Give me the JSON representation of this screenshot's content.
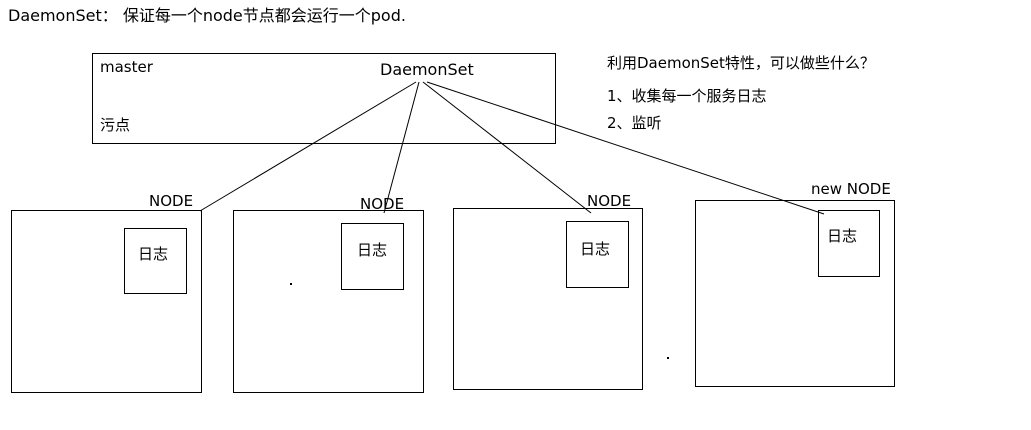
{
  "header": {
    "text": "DaemonSet： 保证每一个node节点都会运行一个pod."
  },
  "master_box": {
    "label": "master",
    "taint_label": "污点",
    "daemonset_label": "DaemonSet"
  },
  "notes": {
    "question": "利用DaemonSet特性，可以做些什么？",
    "items": [
      "1、收集每一个服务日志",
      "2、监听"
    ]
  },
  "nodes": [
    {
      "label": "NODE",
      "log_label": "日志"
    },
    {
      "label": "NODE",
      "log_label": "日志"
    },
    {
      "label": "NODE",
      "log_label": "日志"
    },
    {
      "label": "new NODE",
      "log_label": "日志"
    }
  ]
}
